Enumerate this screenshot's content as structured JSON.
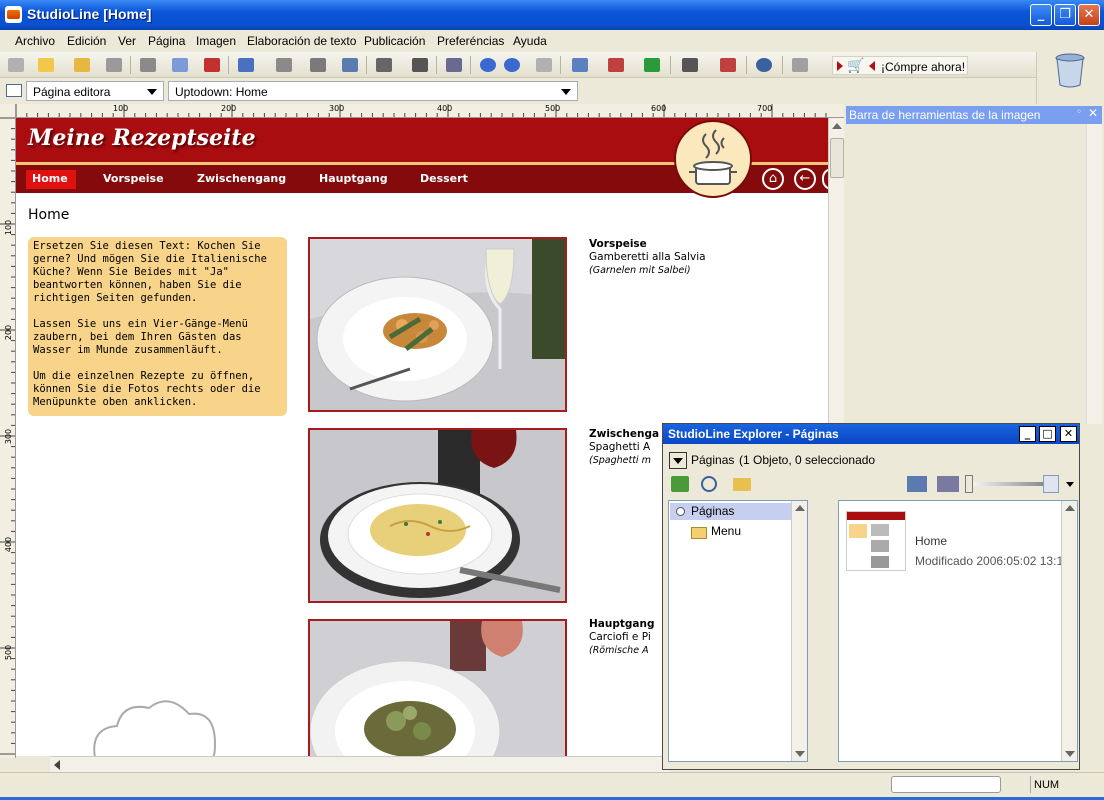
{
  "window": {
    "title": "StudioLine [Home]"
  },
  "menu": [
    "Archivo",
    "Edición",
    "Ver",
    "Página",
    "Imagen",
    "Elaboración de texto",
    "Publicación",
    "Preferéncias",
    "Ayuda"
  ],
  "toolbar": {
    "buy_label": "¡Cómpre ahora!"
  },
  "combos": {
    "view": "Página editora",
    "page": "Uptodown: Home"
  },
  "ruler": {
    "h_ticks": [
      "100",
      "200",
      "300",
      "400",
      "500",
      "600",
      "700"
    ],
    "v_ticks": [
      "100",
      "200",
      "300",
      "400",
      "500"
    ]
  },
  "site": {
    "title": "Meine Rezeptseite",
    "nav": [
      "Home",
      "Vorspeise",
      "Zwischengang",
      "Hauptgang",
      "Dessert"
    ],
    "heading": "Home",
    "intro": [
      "Ersetzen Sie diesen Text: Kochen Sie gerne? Und mögen Sie die Italienische Küche? Wenn Sie Beides mit \"Ja\" beantworten können, haben Sie die richtigen Seiten gefunden.",
      "Lassen Sie uns ein Vier-Gänge-Menü zaubern, bei dem Ihren Gästen das Wasser im Munde zusammenläuft.",
      "Um die einzelnen Rezepte zu öffnen, können Sie die Fotos rechts oder die Menüpunkte oben anklicken."
    ],
    "courses": [
      {
        "heading": "Vorspeise",
        "dish": "Gamberetti alla Salvia",
        "sub": "(Garnelen mit Salbei)"
      },
      {
        "heading": "Zwischenga",
        "dish": "Spaghetti A",
        "sub": "(Spaghetti m"
      },
      {
        "heading": "Hauptgang",
        "dish": "Carciofi e Pi",
        "sub": "(Römische A"
      }
    ]
  },
  "image_panel": {
    "title": "Barra de herramientas de la imagen"
  },
  "explorer": {
    "title": "StudioLine Explorer - Páginas",
    "path_label": "Páginas",
    "count": "(1 Objeto, 0 seleccionado",
    "tree": [
      "Páginas",
      "Menu"
    ],
    "item": {
      "name": "Home",
      "modified": "Modificado 2006:05:02 13:1"
    }
  },
  "status": {
    "num": "NUM"
  },
  "colors": {
    "brand_red": "#a90d10",
    "nav_red": "#840a0c",
    "intro_bg": "#f8d38a",
    "titlebar": "#0a55d8"
  }
}
